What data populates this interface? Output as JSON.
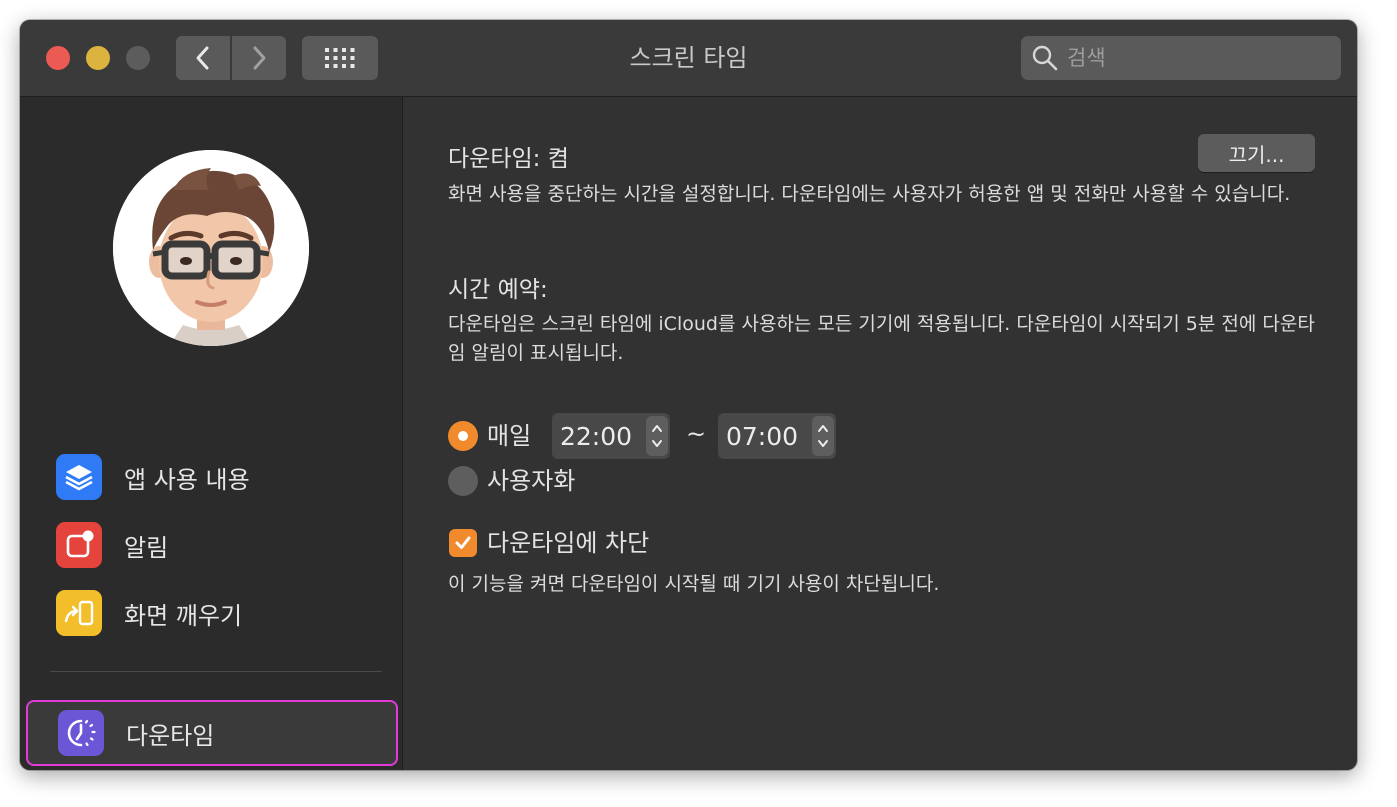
{
  "window": {
    "title": "스크린 타임"
  },
  "search": {
    "placeholder": "검색"
  },
  "sidebar": {
    "items": [
      {
        "label": "앱 사용 내용",
        "icon": "layers-icon",
        "color": "#2f7bf5"
      },
      {
        "label": "알림",
        "icon": "notification-icon",
        "color": "#e5443c"
      },
      {
        "label": "화면 깨우기",
        "icon": "pickup-icon",
        "color": "#f2bf2b"
      },
      {
        "label": "다운타임",
        "icon": "downtime-icon",
        "color": "#6b57d6",
        "selected": true
      }
    ]
  },
  "downtime": {
    "heading": "다운타임: 켬",
    "off_button": "끄기...",
    "description": "화면 사용을 중단하는 시간을 설정합니다. 다운타임에는 사용자가 허용한 앱 및 전화만 사용할 수 있습니다.",
    "schedule_heading": "시간 예약:",
    "schedule_description": "다운타임은 스크린 타임에 iCloud를 사용하는 모든 기기에 적용됩니다. 다운타임이 시작되기 5분 전에 다운타임 알림이 표시됩니다.",
    "daily_label": "매일",
    "start_time": "22:00",
    "range_separator": "~",
    "end_time": "07:00",
    "custom_label": "사용자화",
    "schedule_mode": "daily",
    "block_label": "다운타임에 차단",
    "block_checked": true,
    "block_description": "이 기능을 켜면 다운타임이 시작될 때 기기 사용이 차단됩니다."
  },
  "colors": {
    "accent": "#f08a2d",
    "selection_outline": "#e23ad9"
  }
}
